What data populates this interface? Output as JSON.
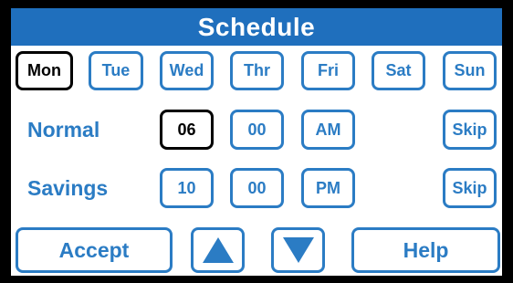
{
  "header": {
    "title": "Schedule"
  },
  "days": [
    {
      "label": "Mon",
      "selected": true
    },
    {
      "label": "Tue",
      "selected": false
    },
    {
      "label": "Wed",
      "selected": false
    },
    {
      "label": "Thr",
      "selected": false
    },
    {
      "label": "Fri",
      "selected": false
    },
    {
      "label": "Sat",
      "selected": false
    },
    {
      "label": "Sun",
      "selected": false
    }
  ],
  "normal": {
    "label": "Normal",
    "hour": "06",
    "minute": "00",
    "ampm": "AM",
    "skip": "Skip"
  },
  "savings": {
    "label": "Savings",
    "hour": "10",
    "minute": "00",
    "ampm": "PM",
    "skip": "Skip"
  },
  "footer": {
    "accept": "Accept",
    "up_icon": "arrow-up-icon",
    "down_icon": "arrow-down-icon",
    "help": "Help"
  },
  "colors": {
    "accent": "#2b7cc4",
    "title_bar": "#1f6fbd",
    "selected": "#000000",
    "frame": "#000000"
  }
}
